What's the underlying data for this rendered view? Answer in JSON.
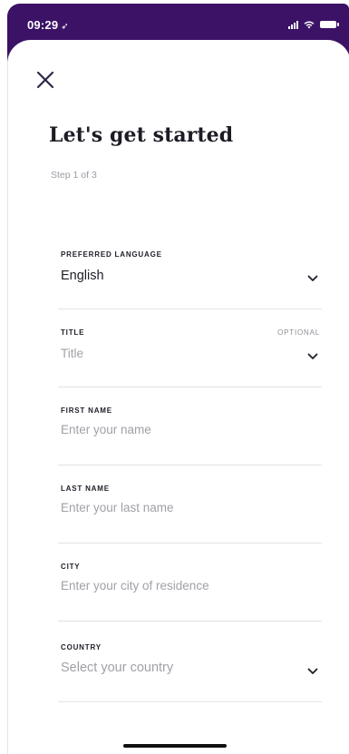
{
  "status_bar": {
    "time": "09:29",
    "location_glyph": "➶",
    "icons": [
      "signal-icon",
      "wifi-icon",
      "battery-icon"
    ],
    "background": "#3b1266"
  },
  "header": {
    "close_icon": "close-icon",
    "title": "Let's get started",
    "step": "Step 1 of 3"
  },
  "form": {
    "preferred_language": {
      "label": "PREFERRED LANGUAGE",
      "value": "English"
    },
    "title": {
      "label": "TITLE",
      "optional": "OPTIONAL",
      "placeholder": "Title"
    },
    "first_name": {
      "label": "FIRST NAME",
      "placeholder": "Enter your name"
    },
    "last_name": {
      "label": "LAST NAME",
      "placeholder": "Enter your last name"
    },
    "city": {
      "label": "CITY",
      "placeholder": "Enter your city of residence"
    },
    "country": {
      "label": "COUNTRY",
      "placeholder": "Select your country"
    }
  },
  "colors": {
    "accent": "#3b1266",
    "text_primary": "#1f1d27",
    "text_muted": "#a0a0a8",
    "divider": "#e3e3e8"
  }
}
